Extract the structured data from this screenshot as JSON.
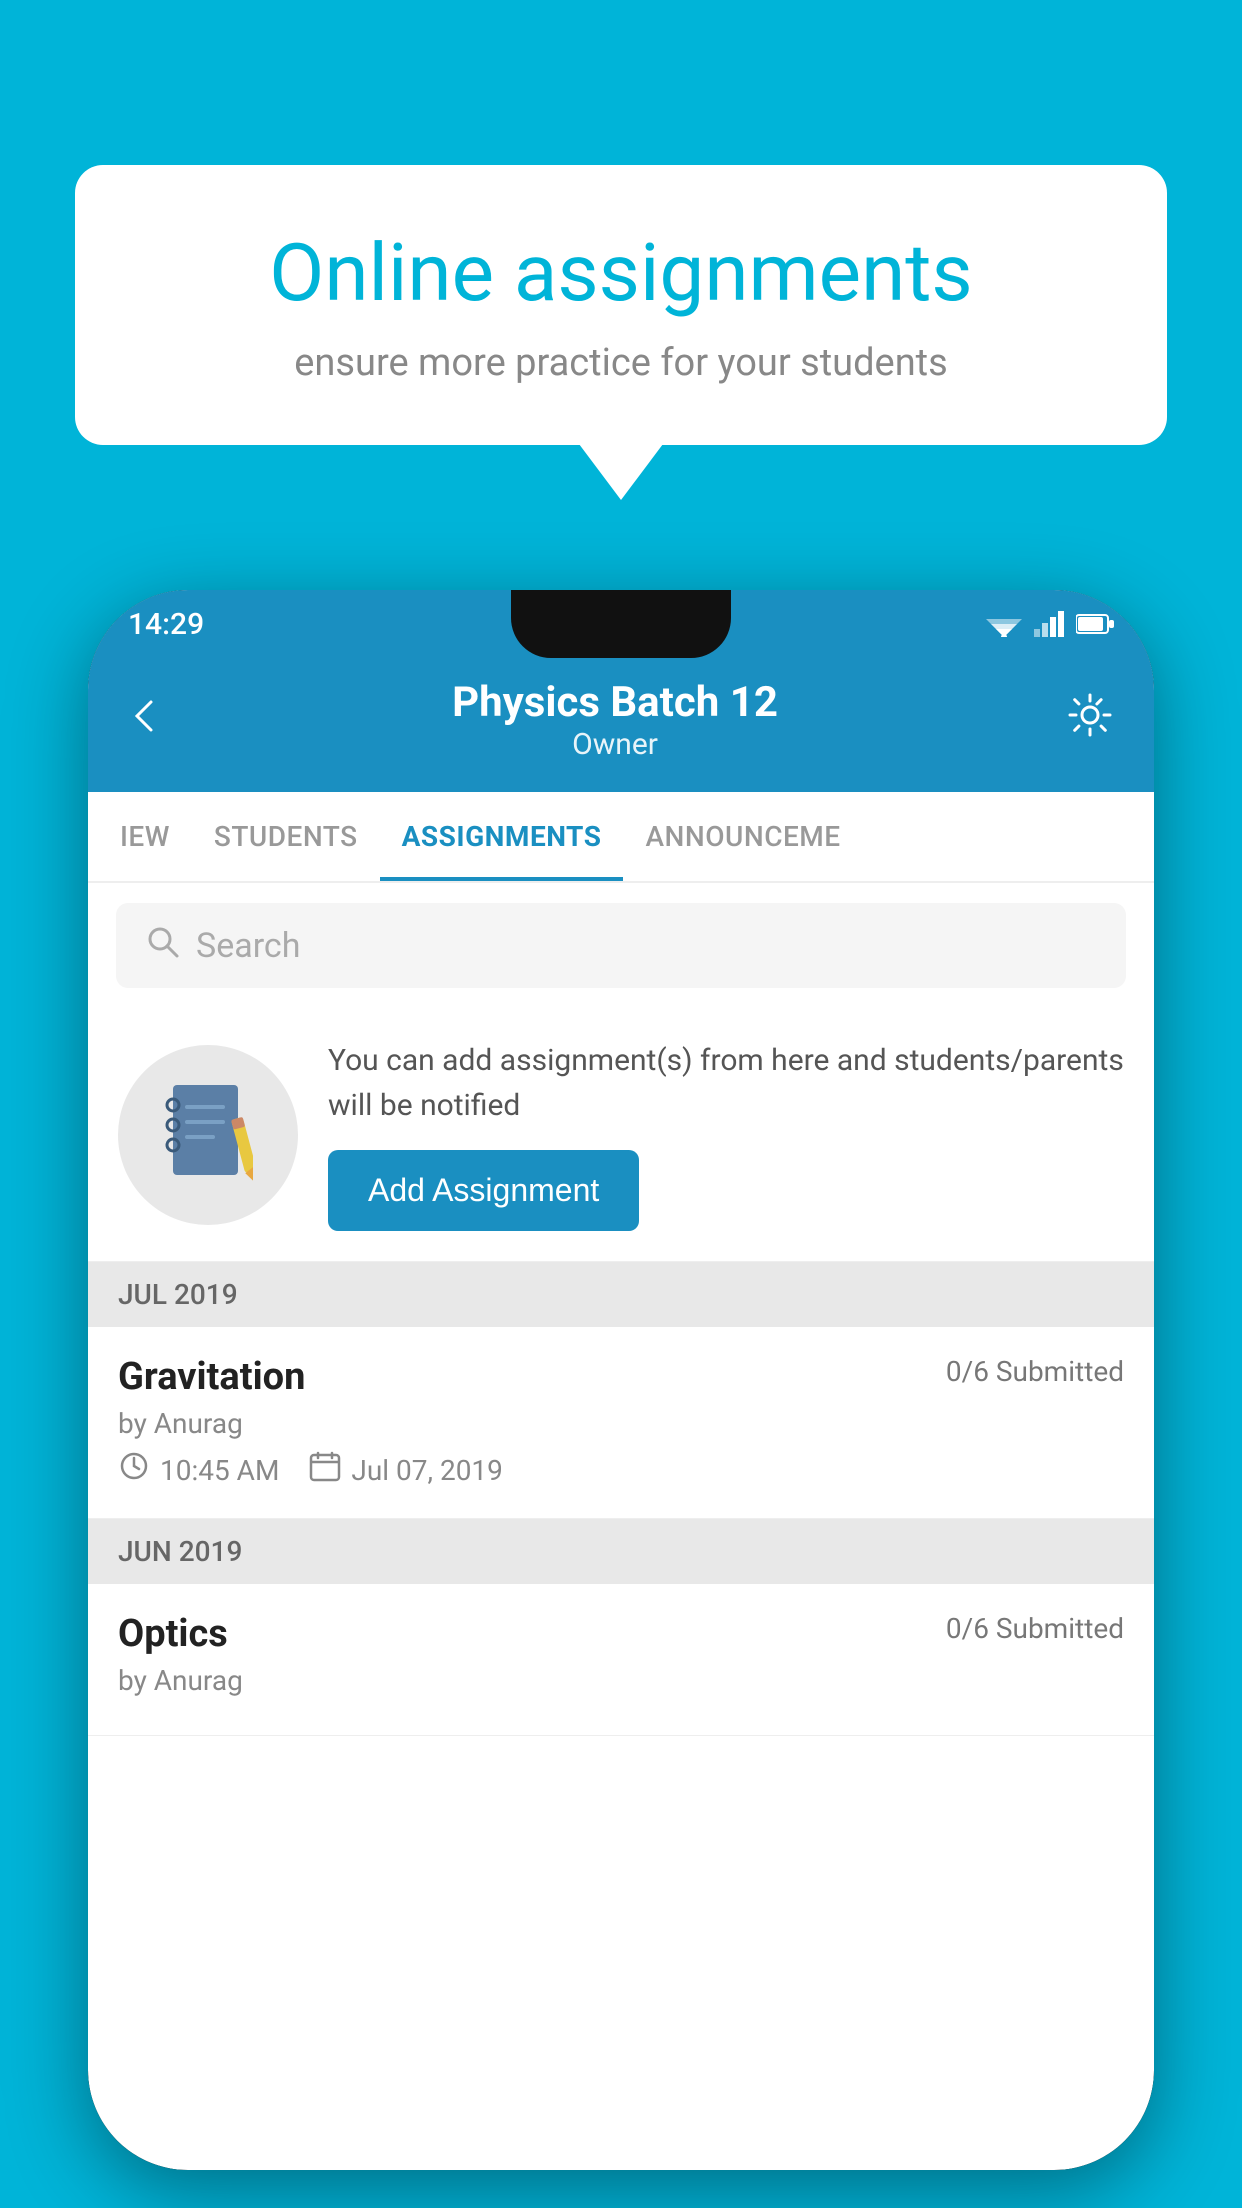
{
  "background_color": "#00B4D8",
  "bubble": {
    "title": "Online assignments",
    "subtitle": "ensure more practice for your students"
  },
  "status_bar": {
    "time": "14:29"
  },
  "header": {
    "title": "Physics Batch 12",
    "subtitle": "Owner"
  },
  "tabs": [
    {
      "label": "IEW",
      "active": false
    },
    {
      "label": "STUDENTS",
      "active": false
    },
    {
      "label": "ASSIGNMENTS",
      "active": true
    },
    {
      "label": "ANNOUNCEME",
      "active": false
    }
  ],
  "search": {
    "placeholder": "Search"
  },
  "add_assignment": {
    "description": "You can add assignment(s) from here and students/parents will be notified",
    "button_label": "Add Assignment"
  },
  "sections": [
    {
      "month": "JUL 2019",
      "assignments": [
        {
          "name": "Gravitation",
          "submitted": "0/6 Submitted",
          "by": "by Anurag",
          "time": "10:45 AM",
          "date": "Jul 07, 2019"
        }
      ]
    },
    {
      "month": "JUN 2019",
      "assignments": [
        {
          "name": "Optics",
          "submitted": "0/6 Submitted",
          "by": "by Anurag",
          "time": "",
          "date": ""
        }
      ]
    }
  ]
}
